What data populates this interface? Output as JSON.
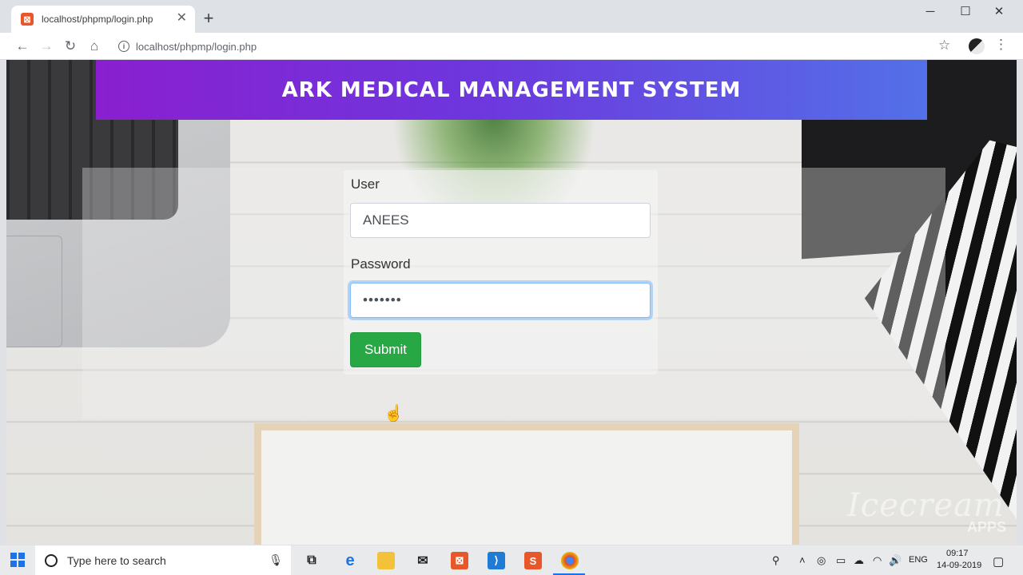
{
  "browser": {
    "tab_title": "localhost/phpmp/login.php",
    "new_tab_label": "+",
    "tab_close": "✕",
    "url": "localhost/phpmp/login.php",
    "window_controls": {
      "minimize": "─",
      "maximize": "☐",
      "close": "✕"
    },
    "nav": {
      "back": "←",
      "forward": "→",
      "reload": "↻",
      "home": "⌂"
    },
    "star": "☆",
    "menu": "⋮",
    "info": "i"
  },
  "page": {
    "title": "ARK MEDICAL MANAGEMENT SYSTEM",
    "user_label": "User",
    "user_value": "ANEES",
    "password_label": "Password",
    "password_value": "•••••••",
    "submit_label": "Submit"
  },
  "watermark": {
    "text": "Icecream",
    "sub": "APPS"
  },
  "taskbar": {
    "search_placeholder": "Type here to search",
    "language": "ENG",
    "time": "09:17",
    "date": "14-09-2019"
  },
  "colors": {
    "banner_start": "#8a1fcf",
    "banner_end": "#5370e8",
    "submit_green": "#28a745",
    "focus_blue": "#80bdff"
  },
  "icons": [
    "xampp-favicon-icon",
    "info-icon",
    "star-icon",
    "menu-icon",
    "windows-start-icon",
    "search-icon",
    "mic-icon",
    "task-view-icon",
    "edge-icon",
    "file-explorer-icon",
    "mail-icon",
    "xampp-icon",
    "vscode-icon",
    "sublime-icon",
    "chrome-icon",
    "wifi-icon",
    "volume-icon",
    "notification-icon"
  ]
}
